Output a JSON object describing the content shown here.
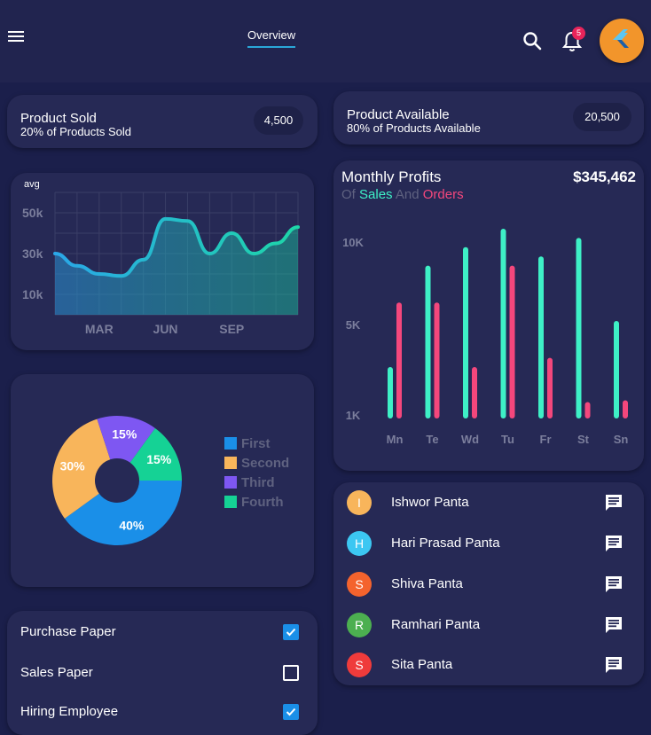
{
  "appbar": {
    "tab_label": "Overview",
    "notification_count": "5"
  },
  "stats": [
    {
      "title": "Product Sold",
      "subtitle": "20% of Products Sold",
      "value": "4,500"
    },
    {
      "title": "Product Available",
      "subtitle": "80% of Products Available",
      "value": "20,500"
    }
  ],
  "colors": {
    "background": "#1b1f4b",
    "card": "#262955",
    "sales": "#3ef0c6",
    "orders": "#f4477c",
    "pie": [
      "#1a8fe8",
      "#f8b55b",
      "#7e57f2",
      "#15d295"
    ]
  },
  "chart_data": [
    {
      "type": "area",
      "title": "",
      "ylabel": "avg",
      "categories": [
        "MAR",
        "JUN",
        "SEP"
      ],
      "x": [
        0,
        1,
        2,
        3,
        4,
        5,
        6,
        7,
        8,
        9,
        10,
        11
      ],
      "values": [
        30,
        24,
        20,
        19,
        27,
        47,
        46,
        30,
        40,
        30,
        35,
        43
      ],
      "y_ticks": [
        "50k",
        "30k",
        "10k"
      ],
      "ylim": [
        0,
        60
      ],
      "grid": true
    },
    {
      "type": "pie",
      "title": "",
      "slices": [
        {
          "name": "First",
          "value": 40,
          "label": "40%"
        },
        {
          "name": "Second",
          "value": 30,
          "label": "30%"
        },
        {
          "name": "Third",
          "value": 15,
          "label": "15%"
        },
        {
          "name": "Fourth",
          "value": 15,
          "label": "15%"
        }
      ],
      "legend_position": "right"
    },
    {
      "type": "bar",
      "title": "Monthly Profits",
      "subtitle_parts": [
        "Of",
        "Sales",
        "And",
        "Orders"
      ],
      "total": "$345,462",
      "categories": [
        "Mn",
        "Te",
        "Wd",
        "Tu",
        "Fr",
        "St",
        "Sn"
      ],
      "y_ticks": [
        "10K",
        "5K",
        "1K"
      ],
      "ylim": [
        0,
        10000
      ],
      "series": [
        {
          "name": "Sales",
          "values": [
            2500,
            8000,
            9000,
            10000,
            8500,
            9500,
            5000
          ]
        },
        {
          "name": "Orders",
          "values": [
            6000,
            6000,
            2500,
            8000,
            3000,
            600,
            700
          ]
        }
      ]
    }
  ],
  "contacts": [
    {
      "initial": "I",
      "name": "Ishwor Panta",
      "color": "#f8b55b"
    },
    {
      "initial": "H",
      "name": "Hari Prasad Panta",
      "color": "#3cc7f2"
    },
    {
      "initial": "S",
      "name": "Shiva Panta",
      "color": "#f4632d"
    },
    {
      "initial": "R",
      "name": "Ramhari Panta",
      "color": "#4caf50"
    },
    {
      "initial": "S",
      "name": "Sita Panta",
      "color": "#ef3b3b"
    }
  ],
  "tasks": [
    {
      "label": "Purchase Paper",
      "checked": true
    },
    {
      "label": "Sales Paper",
      "checked": false
    },
    {
      "label": "Hiring Employee",
      "checked": true
    }
  ]
}
